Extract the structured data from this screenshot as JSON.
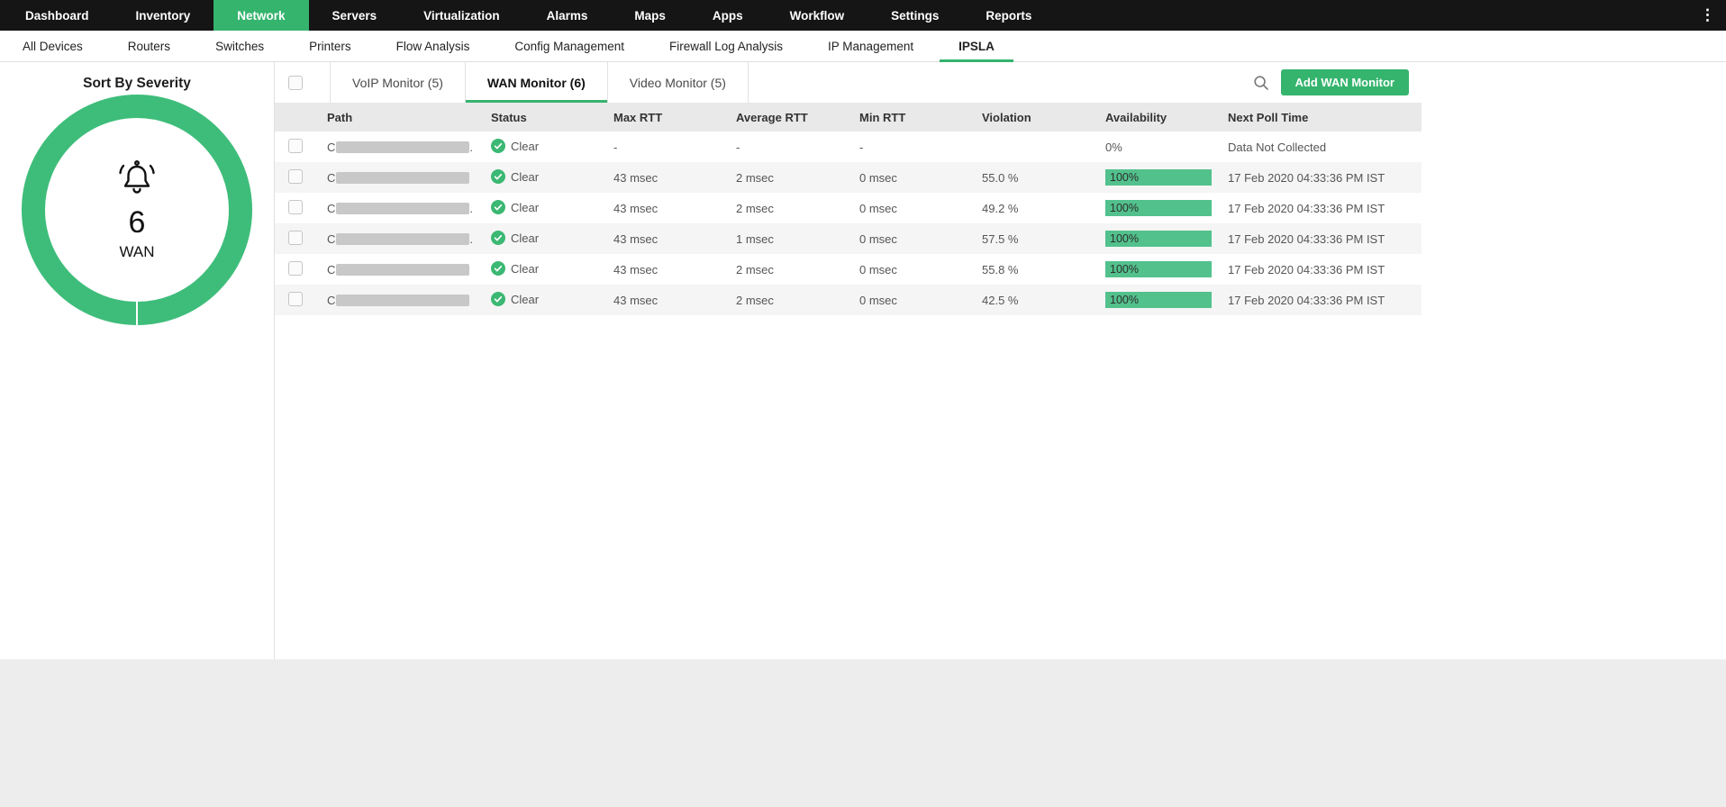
{
  "colors": {
    "accent": "#35b46e",
    "donut": "#3ebd7a",
    "availability_bar": "#52c18c",
    "status_ok": "#3bb873",
    "topbar": "#151515"
  },
  "icons": {
    "menu": "kebab-menu-icon",
    "severity": "bell-icon",
    "search": "search-icon",
    "status_ok": "check-circle-icon"
  },
  "topnav": {
    "items": [
      {
        "label": "Dashboard",
        "active": false
      },
      {
        "label": "Inventory",
        "active": false
      },
      {
        "label": "Network",
        "active": true
      },
      {
        "label": "Servers",
        "active": false
      },
      {
        "label": "Virtualization",
        "active": false
      },
      {
        "label": "Alarms",
        "active": false
      },
      {
        "label": "Maps",
        "active": false
      },
      {
        "label": "Apps",
        "active": false
      },
      {
        "label": "Workflow",
        "active": false
      },
      {
        "label": "Settings",
        "active": false
      },
      {
        "label": "Reports",
        "active": false
      }
    ]
  },
  "subnav": {
    "items": [
      {
        "label": "All Devices",
        "active": false
      },
      {
        "label": "Routers",
        "active": false
      },
      {
        "label": "Switches",
        "active": false
      },
      {
        "label": "Printers",
        "active": false
      },
      {
        "label": "Flow Analysis",
        "active": false
      },
      {
        "label": "Config Management",
        "active": false
      },
      {
        "label": "Firewall Log Analysis",
        "active": false
      },
      {
        "label": "IP Management",
        "active": false
      },
      {
        "label": "IPSLA",
        "active": true
      }
    ]
  },
  "sidebar": {
    "title": "Sort By Severity",
    "donut": {
      "count": "6",
      "label": "WAN"
    }
  },
  "main": {
    "tabs": [
      {
        "label": "VoIP Monitor (5)",
        "active": false
      },
      {
        "label": "WAN Monitor (6)",
        "active": true
      },
      {
        "label": "Video Monitor (5)",
        "active": false
      }
    ],
    "add_button_label": "Add WAN Monitor",
    "table": {
      "columns": [
        "Path",
        "Status",
        "Max RTT",
        "Average RTT",
        "Min RTT",
        "Violation",
        "Availability",
        "Next Poll Time"
      ],
      "rows": [
        {
          "path_prefix": "C",
          "path_redacted": true,
          "path_suffix": ".",
          "status": "Clear",
          "max_rtt": "-",
          "avg_rtt": "-",
          "min_rtt": "-",
          "violation": "",
          "availability": "0%",
          "availability_bar": false,
          "next_poll": "Data Not Collected"
        },
        {
          "path_prefix": "C",
          "path_redacted": true,
          "path_suffix": "",
          "status": "Clear",
          "max_rtt": "43 msec",
          "avg_rtt": "2 msec",
          "min_rtt": "0 msec",
          "violation": "55.0 %",
          "availability": "100%",
          "availability_bar": true,
          "next_poll": "17 Feb 2020 04:33:36 PM IST"
        },
        {
          "path_prefix": "C",
          "path_redacted": true,
          "path_suffix": ".",
          "status": "Clear",
          "max_rtt": "43 msec",
          "avg_rtt": "2 msec",
          "min_rtt": "0 msec",
          "violation": "49.2 %",
          "availability": "100%",
          "availability_bar": true,
          "next_poll": "17 Feb 2020 04:33:36 PM IST"
        },
        {
          "path_prefix": "C",
          "path_redacted": true,
          "path_suffix": ".",
          "status": "Clear",
          "max_rtt": "43 msec",
          "avg_rtt": "1 msec",
          "min_rtt": "0 msec",
          "violation": "57.5 %",
          "availability": "100%",
          "availability_bar": true,
          "next_poll": "17 Feb 2020 04:33:36 PM IST"
        },
        {
          "path_prefix": "C",
          "path_redacted": true,
          "path_suffix": "",
          "status": "Clear",
          "max_rtt": "43 msec",
          "avg_rtt": "2 msec",
          "min_rtt": "0 msec",
          "violation": "55.8 %",
          "availability": "100%",
          "availability_bar": true,
          "next_poll": "17 Feb 2020 04:33:36 PM IST"
        },
        {
          "path_prefix": "C",
          "path_redacted": true,
          "path_suffix": "",
          "status": "Clear",
          "max_rtt": "43 msec",
          "avg_rtt": "2 msec",
          "min_rtt": "0 msec",
          "violation": "42.5 %",
          "availability": "100%",
          "availability_bar": true,
          "next_poll": "17 Feb 2020 04:33:36 PM IST"
        }
      ]
    }
  }
}
